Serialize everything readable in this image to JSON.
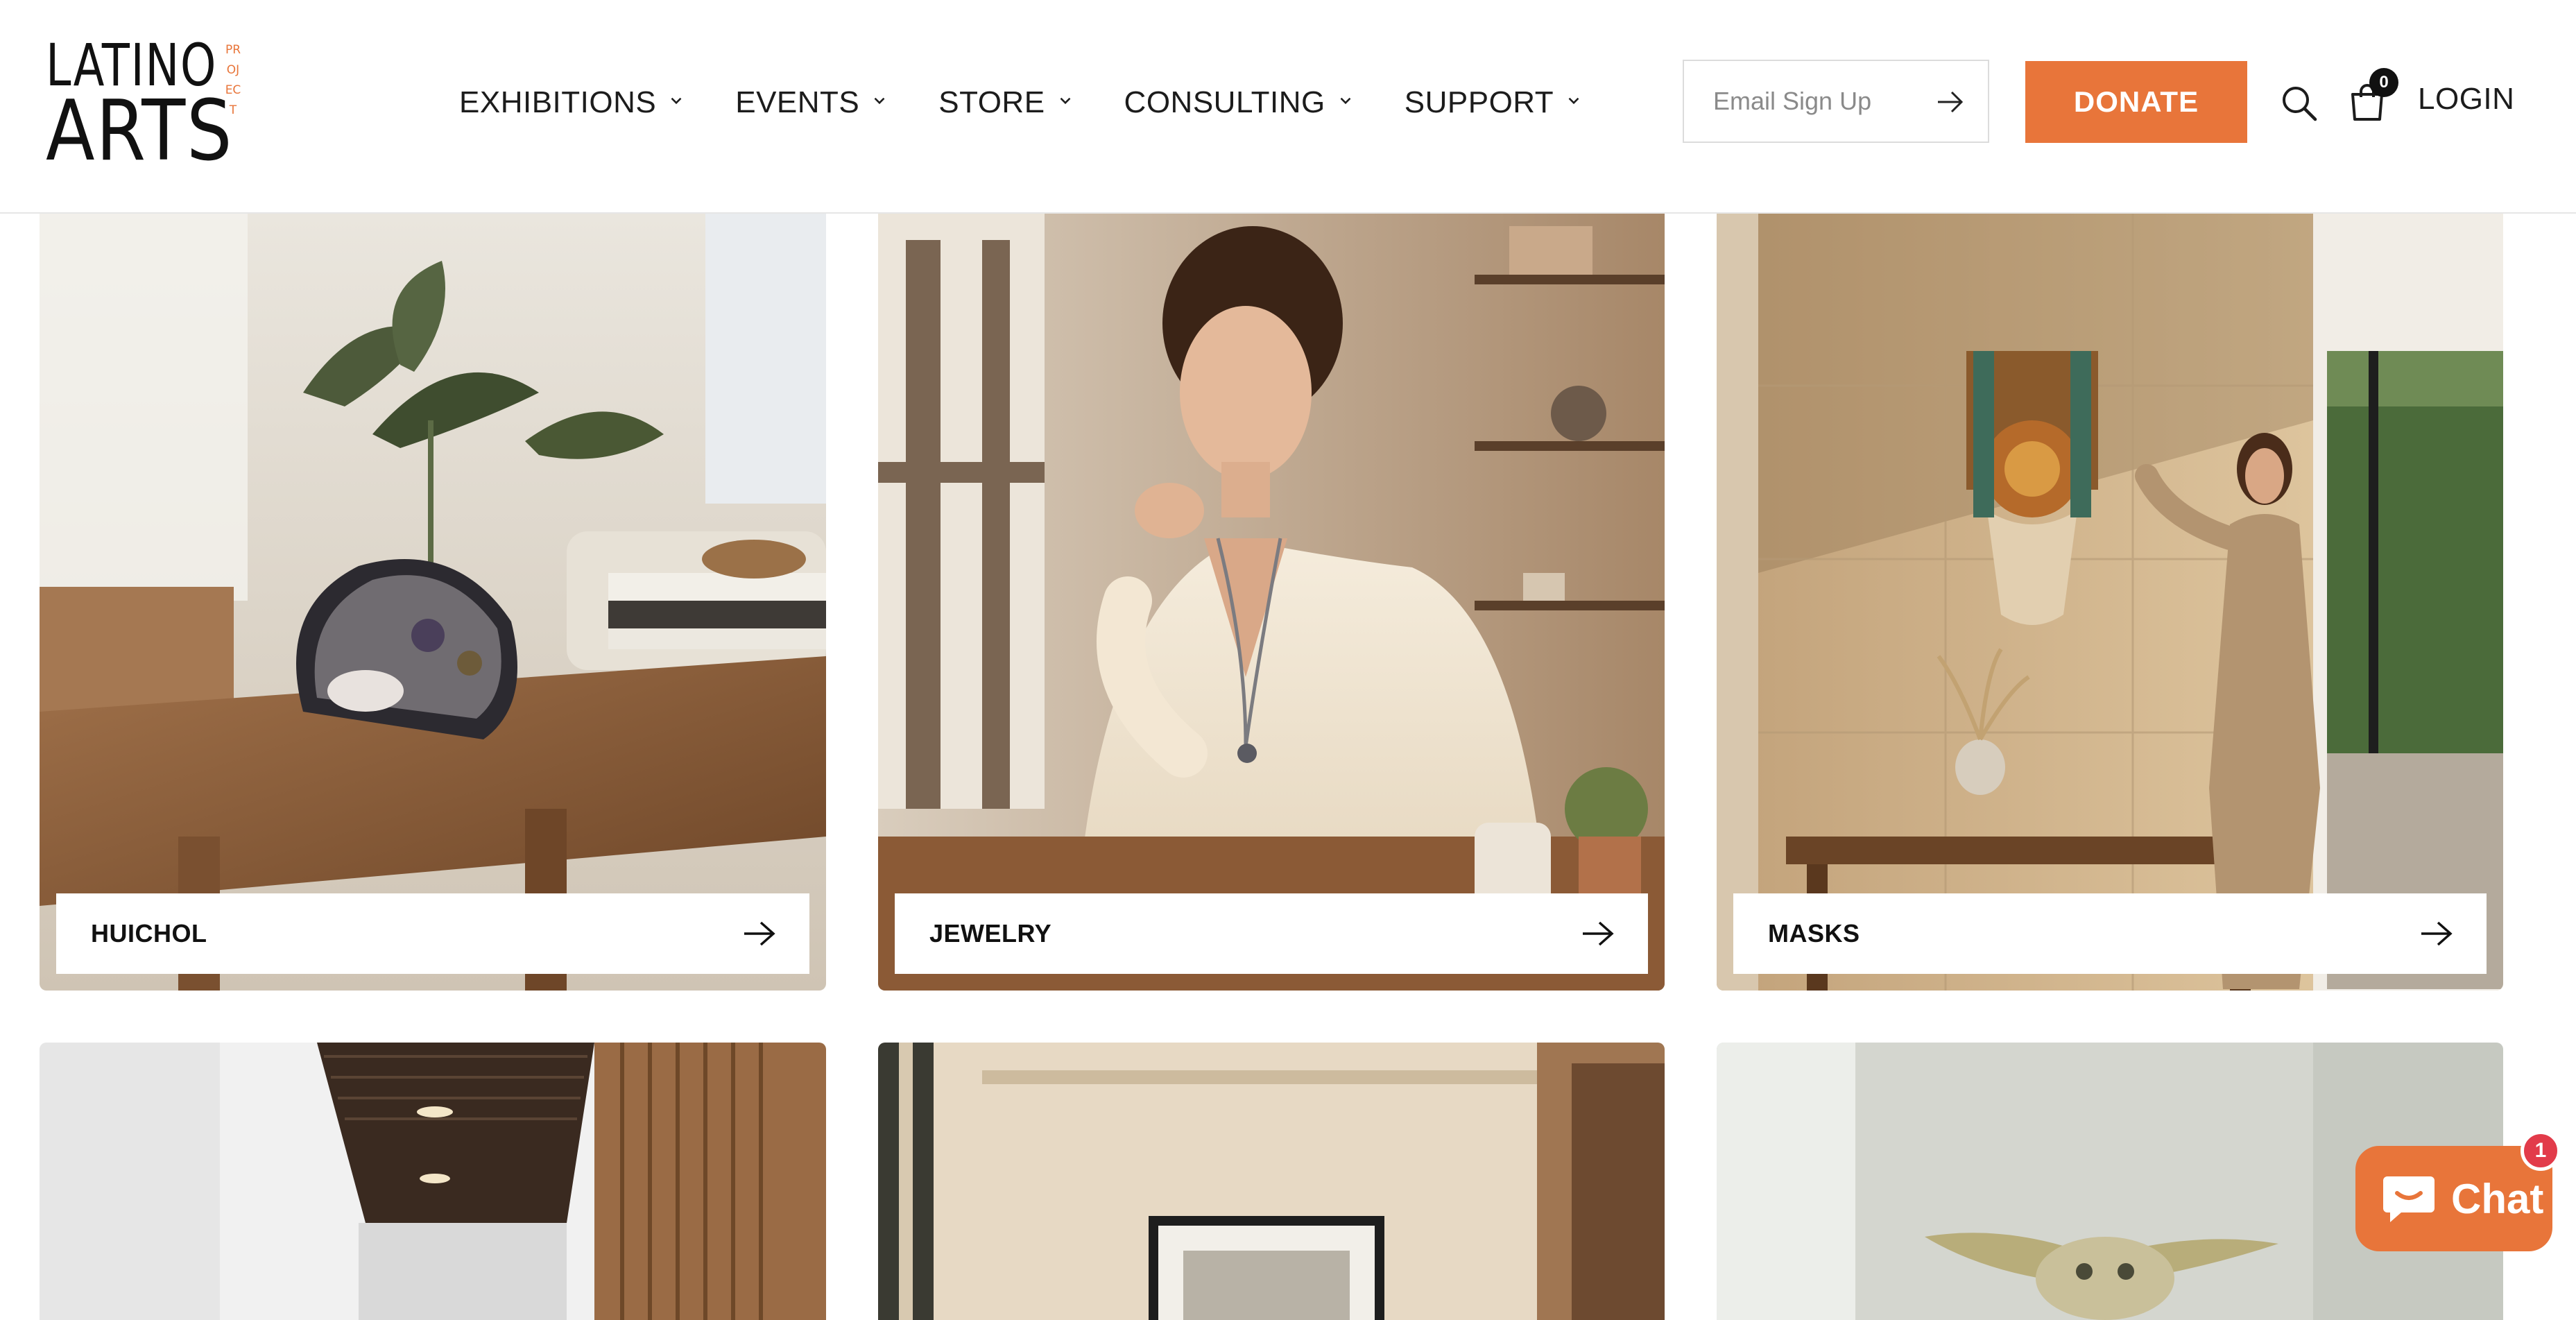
{
  "header": {
    "logo": {
      "line1": "LATINO",
      "line2": "ARTS",
      "vertical": "PROJECT"
    },
    "nav": [
      {
        "label": "EXHIBITIONS"
      },
      {
        "label": "EVENTS"
      },
      {
        "label": "STORE"
      },
      {
        "label": "CONSULTING"
      },
      {
        "label": "SUPPORT"
      }
    ],
    "email": {
      "placeholder": "Email Sign Up",
      "value": ""
    },
    "donate_label": "DONATE",
    "cart_count": "0",
    "login_label": "LOGIN"
  },
  "collections": [
    {
      "label": "HUICHOL"
    },
    {
      "label": "JEWELRY"
    },
    {
      "label": "MASKS"
    },
    {
      "label": ""
    },
    {
      "label": ""
    },
    {
      "label": ""
    }
  ],
  "chat": {
    "label": "Chat",
    "badge": "1"
  },
  "colors": {
    "accent": "#e8753a",
    "badge_red": "#e23b4a",
    "text": "#1c1c1c"
  },
  "icons": [
    "chevron-down-icon",
    "arrow-right-icon",
    "search-icon",
    "cart-icon",
    "chat-bubble-icon"
  ]
}
